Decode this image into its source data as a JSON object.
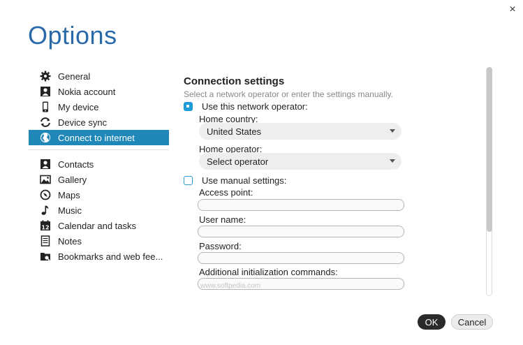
{
  "window": {
    "title": "Options",
    "close_label": "×"
  },
  "sidebar": {
    "items": [
      {
        "label": "General",
        "icon": "gear-icon"
      },
      {
        "label": "Nokia account",
        "icon": "person-icon"
      },
      {
        "label": "My device",
        "icon": "phone-icon"
      },
      {
        "label": "Device sync",
        "icon": "sync-icon"
      },
      {
        "label": "Connect to internet",
        "icon": "globe-icon",
        "active": true
      },
      {
        "label": "Contacts",
        "icon": "contacts-icon"
      },
      {
        "label": "Gallery",
        "icon": "gallery-icon"
      },
      {
        "label": "Maps",
        "icon": "compass-icon"
      },
      {
        "label": "Music",
        "icon": "music-note-icon"
      },
      {
        "label": "Calendar and tasks",
        "icon": "calendar-icon"
      },
      {
        "label": "Notes",
        "icon": "notes-icon"
      },
      {
        "label": "Bookmarks and web fee...",
        "icon": "bookmark-folder-icon"
      }
    ]
  },
  "main": {
    "heading": "Connection settings",
    "subtitle": "Select a network operator or enter the settings manually.",
    "option_operator": {
      "label": "Use this network operator:",
      "checked": true
    },
    "home_country": {
      "label": "Home country:",
      "value": "United States"
    },
    "home_operator": {
      "label": "Home operator:",
      "value": "Select operator"
    },
    "option_manual": {
      "label": "Use manual settings:",
      "checked": false
    },
    "access_point": {
      "label": "Access point:",
      "value": ""
    },
    "user_name": {
      "label": "User name:",
      "value": ""
    },
    "password": {
      "label": "Password:",
      "value": ""
    },
    "init_commands": {
      "label": "Additional initialization commands:",
      "value": ""
    }
  },
  "footer": {
    "ok_label": "OK",
    "cancel_label": "Cancel"
  },
  "watermark": "www.softpedia.com",
  "colors": {
    "accent": "#1f88b8",
    "title": "#2a6aa8",
    "checkbox": "#1f9bd6"
  }
}
